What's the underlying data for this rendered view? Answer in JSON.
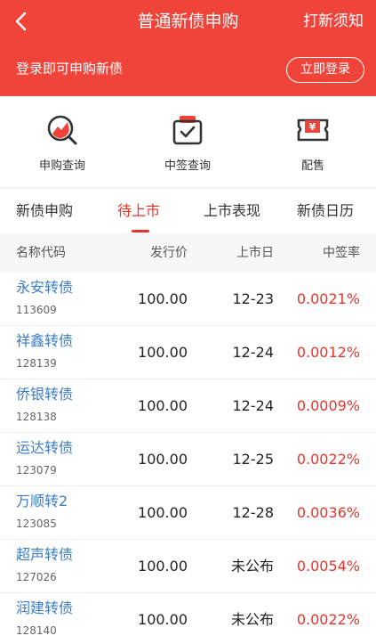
{
  "header": {
    "title": "普通新债申购",
    "notice_label": "打新须知",
    "login_text": "登录即可申购新债",
    "login_button": "立即登录"
  },
  "quick_actions": [
    {
      "label": "申购查询",
      "icon": "search-chart-icon"
    },
    {
      "label": "中签查询",
      "icon": "check-box-icon"
    },
    {
      "label": "配售",
      "icon": "yuan-ticket-icon"
    }
  ],
  "tabs": [
    {
      "label": "新债申购",
      "active": false
    },
    {
      "label": "待上市",
      "active": true
    },
    {
      "label": "上市表现",
      "active": false
    },
    {
      "label": "新债日历",
      "active": false
    }
  ],
  "table": {
    "headers": [
      "名称代码",
      "发行价",
      "上市日",
      "中签率"
    ],
    "rows": [
      {
        "name": "永安转债",
        "code": "113609",
        "price": "100.00",
        "date": "12-23",
        "rate": "0.0021%"
      },
      {
        "name": "祥鑫转债",
        "code": "128139",
        "price": "100.00",
        "date": "12-24",
        "rate": "0.0012%"
      },
      {
        "name": "侨银转债",
        "code": "128138",
        "price": "100.00",
        "date": "12-24",
        "rate": "0.0009%"
      },
      {
        "name": "运达转债",
        "code": "123079",
        "price": "100.00",
        "date": "12-25",
        "rate": "0.0022%"
      },
      {
        "name": "万顺转2",
        "code": "123085",
        "price": "100.00",
        "date": "12-28",
        "rate": "0.0036%"
      },
      {
        "name": "超声转债",
        "code": "127026",
        "price": "100.00",
        "date": "未公布",
        "rate": "0.0054%"
      },
      {
        "name": "润建转债",
        "code": "128140",
        "price": "100.00",
        "date": "未公布",
        "rate": "0.0022%"
      }
    ]
  },
  "colors": {
    "header_bg": "#f0433a",
    "accent": "#e8342a",
    "link": "#3a7cc9"
  }
}
